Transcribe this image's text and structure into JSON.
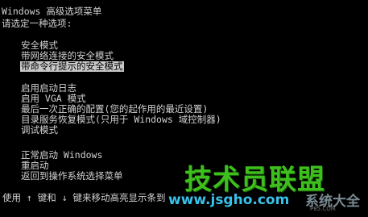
{
  "title": "Windows 高级选项菜单",
  "prompt": "请选定一种选项:",
  "menu_group_1": [
    {
      "label": "安全模式",
      "selected": false
    },
    {
      "label": "带网络连接的安全模式",
      "selected": false
    },
    {
      "label": "带命令行提示的安全模式",
      "selected": true
    }
  ],
  "menu_group_2": [
    {
      "label": "启用启动日志"
    },
    {
      "label": "启用 VGA 模式"
    },
    {
      "label": "最后一次正确的配置(您的起作用的最近设置)"
    },
    {
      "label": "目录服务恢复模式(只用于 Windows 域控制器)"
    },
    {
      "label": "调试模式"
    }
  ],
  "menu_group_3": [
    {
      "label": "正常启动 Windows"
    },
    {
      "label": "重启动"
    },
    {
      "label": "返回到操作系统选择菜单"
    }
  ],
  "footer": "使用 ↑ 键和 ↓ 键来移动高亮显示条到",
  "watermark": {
    "title": "技术员联盟",
    "url": "www.jsgho.com",
    "brand": "系统大全",
    "small": "P85.COM"
  },
  "colors": {
    "background": "#000000",
    "text": "#d2d2d2",
    "highlight_bg": "#c9c9c9",
    "watermark_green": "#3fbf1e",
    "watermark_blue": "#39c1e8"
  }
}
